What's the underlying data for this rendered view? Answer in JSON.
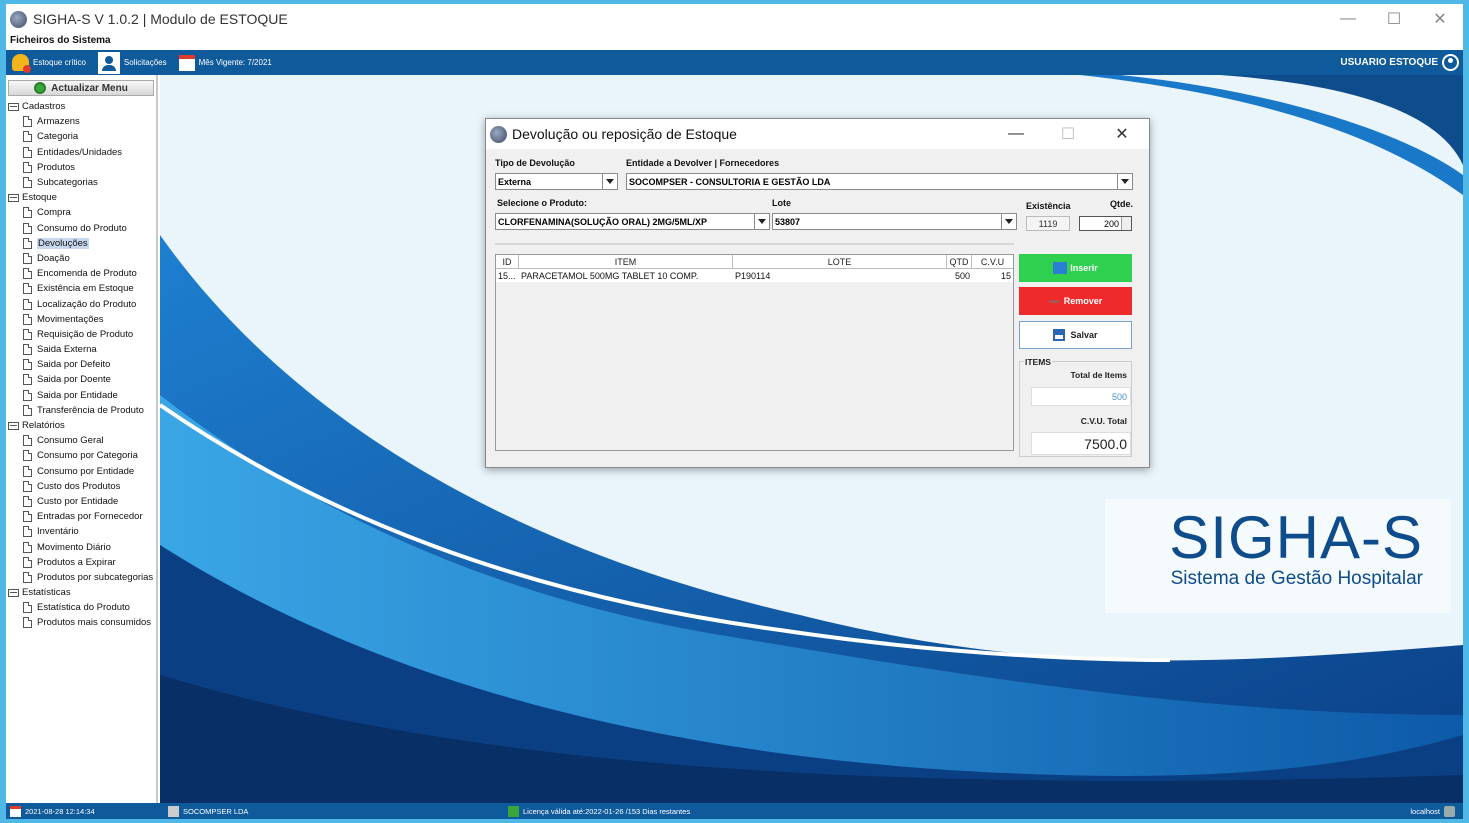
{
  "window": {
    "title": "SIGHA-S V 1.0.2 | Modulo de ESTOQUE",
    "menu": "Ficheiros do Sistema"
  },
  "toolbar": {
    "critical": "Estoque crítico",
    "requests": "Solicitações",
    "period": "Mês Vigente: 7/2021",
    "user": "USUARIO ESTOQUE"
  },
  "sidebar": {
    "update_button": "Actualizar Menu",
    "groups": [
      {
        "label": "Cadastros",
        "items": [
          "Armazens",
          "Categoria",
          "Entidades/Unidades",
          "Produtos",
          "Subcategorias"
        ]
      },
      {
        "label": "Estoque",
        "items": [
          "Compra",
          "Consumo do Produto",
          "Devoluções",
          "Doação",
          "Encomenda de Produto",
          "Existência em Estoque",
          "Localização do Produto",
          "Movimentações",
          "Requisição de Produto",
          "Saida Externa",
          "Saida por Defeito",
          "Saida por Doente",
          "Saida por Entidade",
          "Transferência de Produto"
        ]
      },
      {
        "label": "Relatórios",
        "items": [
          "Consumo Geral",
          "Consumo por Categoria",
          "Consumo por Entidade",
          "Custo dos Produtos",
          "Custo por Entidade",
          "Entradas por Fornecedor",
          "Inventário",
          "Movimento Diário",
          "Produtos a Expirar",
          "Produtos por subcategorias"
        ]
      },
      {
        "label": "Estatísticas",
        "items": [
          "Estatística do Produto",
          "Produtos mais consumidos"
        ]
      }
    ],
    "selected": "Devoluções"
  },
  "brand": {
    "title": "SIGHA-S",
    "subtitle": "Sistema de Gestão Hospitalar"
  },
  "dialog": {
    "title": "Devolução ou reposição de Estoque",
    "tipo_label": "Tipo de Devolução",
    "tipo_value": "Externa",
    "entidade_label": "Entidade a Devolver | Fornecedores",
    "entidade_value": "SOCOMPSER - CONSULTORIA E GESTÃO LDA",
    "produto_label": "Selecione o Produto:",
    "produto_value": "CLORFENAMINA(SOLUÇÃO ORAL) 2MG/5ML/XP",
    "lote_label": "Lote",
    "lote_value": "53807",
    "existencia_label": "Existência",
    "existencia_value": "1119",
    "qtde_label": "Qtde.",
    "qtde_value": "200",
    "table": {
      "headers": [
        "ID",
        "ITEM",
        "LOTE",
        "QTD",
        "C.V.U"
      ],
      "rows": [
        [
          "15...",
          "PARACETAMOL 500MG TABLET 10 COMP.",
          "P190114",
          "500",
          "15"
        ]
      ]
    },
    "btn_insert": "Inserir",
    "btn_remove": "Remover",
    "btn_save": "Salvar",
    "items_title": "ITEMS",
    "total_label": "Total de Items",
    "total_value": "500",
    "cvu_label": "C.V.U. Total",
    "cvu_value": "7500.0"
  },
  "status": {
    "datetime": "2021-08-28 12:14:34",
    "company": "SOCOMPSER LDA",
    "license": "Licença válida até:2022-01-26 /153 Dias restantes",
    "host": "localhost"
  },
  "colors": {
    "toolbar_blue": "#0f5a9b",
    "insert_green": "#2fcf4f",
    "remove_red": "#ef2a2a",
    "brand_blue": "#0e4c8c"
  }
}
